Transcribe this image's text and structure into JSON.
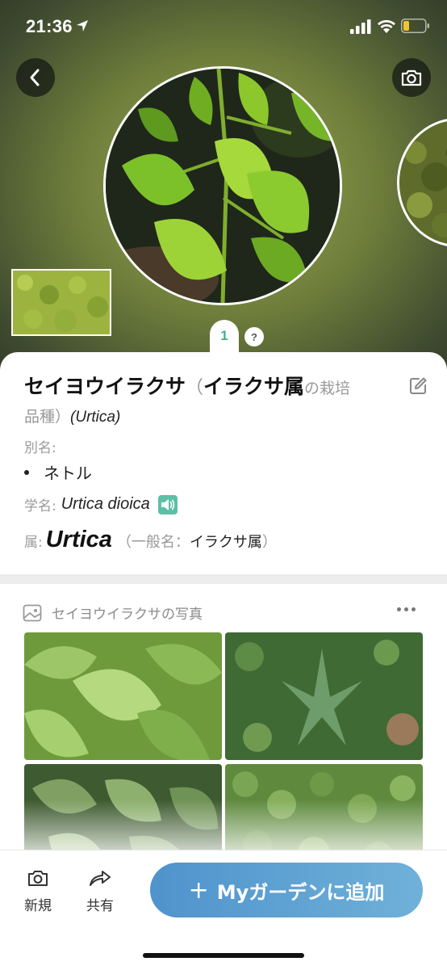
{
  "status_bar": {
    "time": "21:36"
  },
  "hero": {
    "page_number": "1",
    "help_label": "?"
  },
  "plant": {
    "common_name": "セイヨウイラクサ",
    "paren_open": "（",
    "genus_name_jp": "イラクサ属",
    "cultivar_suffix": "の栽培",
    "cultivar_suffix2": "品種）",
    "genus_latin_title": "(Urtica)",
    "alias_label": "別名:",
    "aliases": [
      "ネトル"
    ],
    "scientific_label": "学名:",
    "scientific_name": "Urtica dioica",
    "genus_label": "属:",
    "genus": "Urtica",
    "genus_common_open": "（一般名：",
    "genus_common": "イラクサ属",
    "genus_common_close": "）"
  },
  "photos": {
    "title": "セイヨウイラクサの写真"
  },
  "bottom_bar": {
    "new_label": "新規",
    "share_label": "共有",
    "add_label": "Myガーデンに追加"
  },
  "colors": {
    "accent_green": "#3bb08f",
    "button_gradient_start": "#4f93cd",
    "button_gradient_end": "#6fb1d8",
    "battery_level": "#f2c230"
  },
  "icons": [
    "location-arrow-icon",
    "signal-icon",
    "wifi-icon",
    "battery-icon",
    "back-chevron-icon",
    "camera-icon",
    "edit-icon",
    "speaker-icon",
    "photo-gallery-icon",
    "more-dots-icon",
    "new-camera-icon",
    "share-arrow-icon",
    "plus-icon"
  ]
}
